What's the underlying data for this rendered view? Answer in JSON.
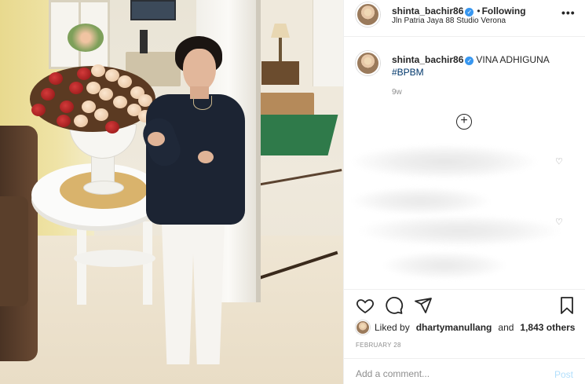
{
  "header": {
    "username": "shinta_bachir86",
    "verified_mark": "✓",
    "separator": "•",
    "follow_status": "Following",
    "location": "Jln Patria Jaya 88 Studio Verona",
    "more_icon": "more-horizontal-icon",
    "more_glyph": "•••"
  },
  "caption": {
    "username": "shinta_bachir86",
    "text": "VINA ADHIGUNA",
    "hashtag": "#BPBM",
    "time_ago": "9w"
  },
  "comments": {
    "load_more_icon": "plus-circle-icon",
    "load_more_glyph": "+",
    "like_glyph": "♡",
    "blurred": true
  },
  "actions": {
    "like_icon": "heart-icon",
    "comment_icon": "comment-icon",
    "share_icon": "paper-plane-icon",
    "save_icon": "bookmark-icon"
  },
  "likes": {
    "prefix": "Liked by",
    "user": "dhartymanullang",
    "conjunction": "and",
    "others": "1,843 others"
  },
  "date": "FEBRUARY 28",
  "comment_box": {
    "placeholder": "Add a comment...",
    "post_label": "Post"
  },
  "colors": {
    "link": "#00376b",
    "verified": "#3897f0",
    "post_disabled": "#b2dffc",
    "muted_text": "#8e8e8e"
  }
}
